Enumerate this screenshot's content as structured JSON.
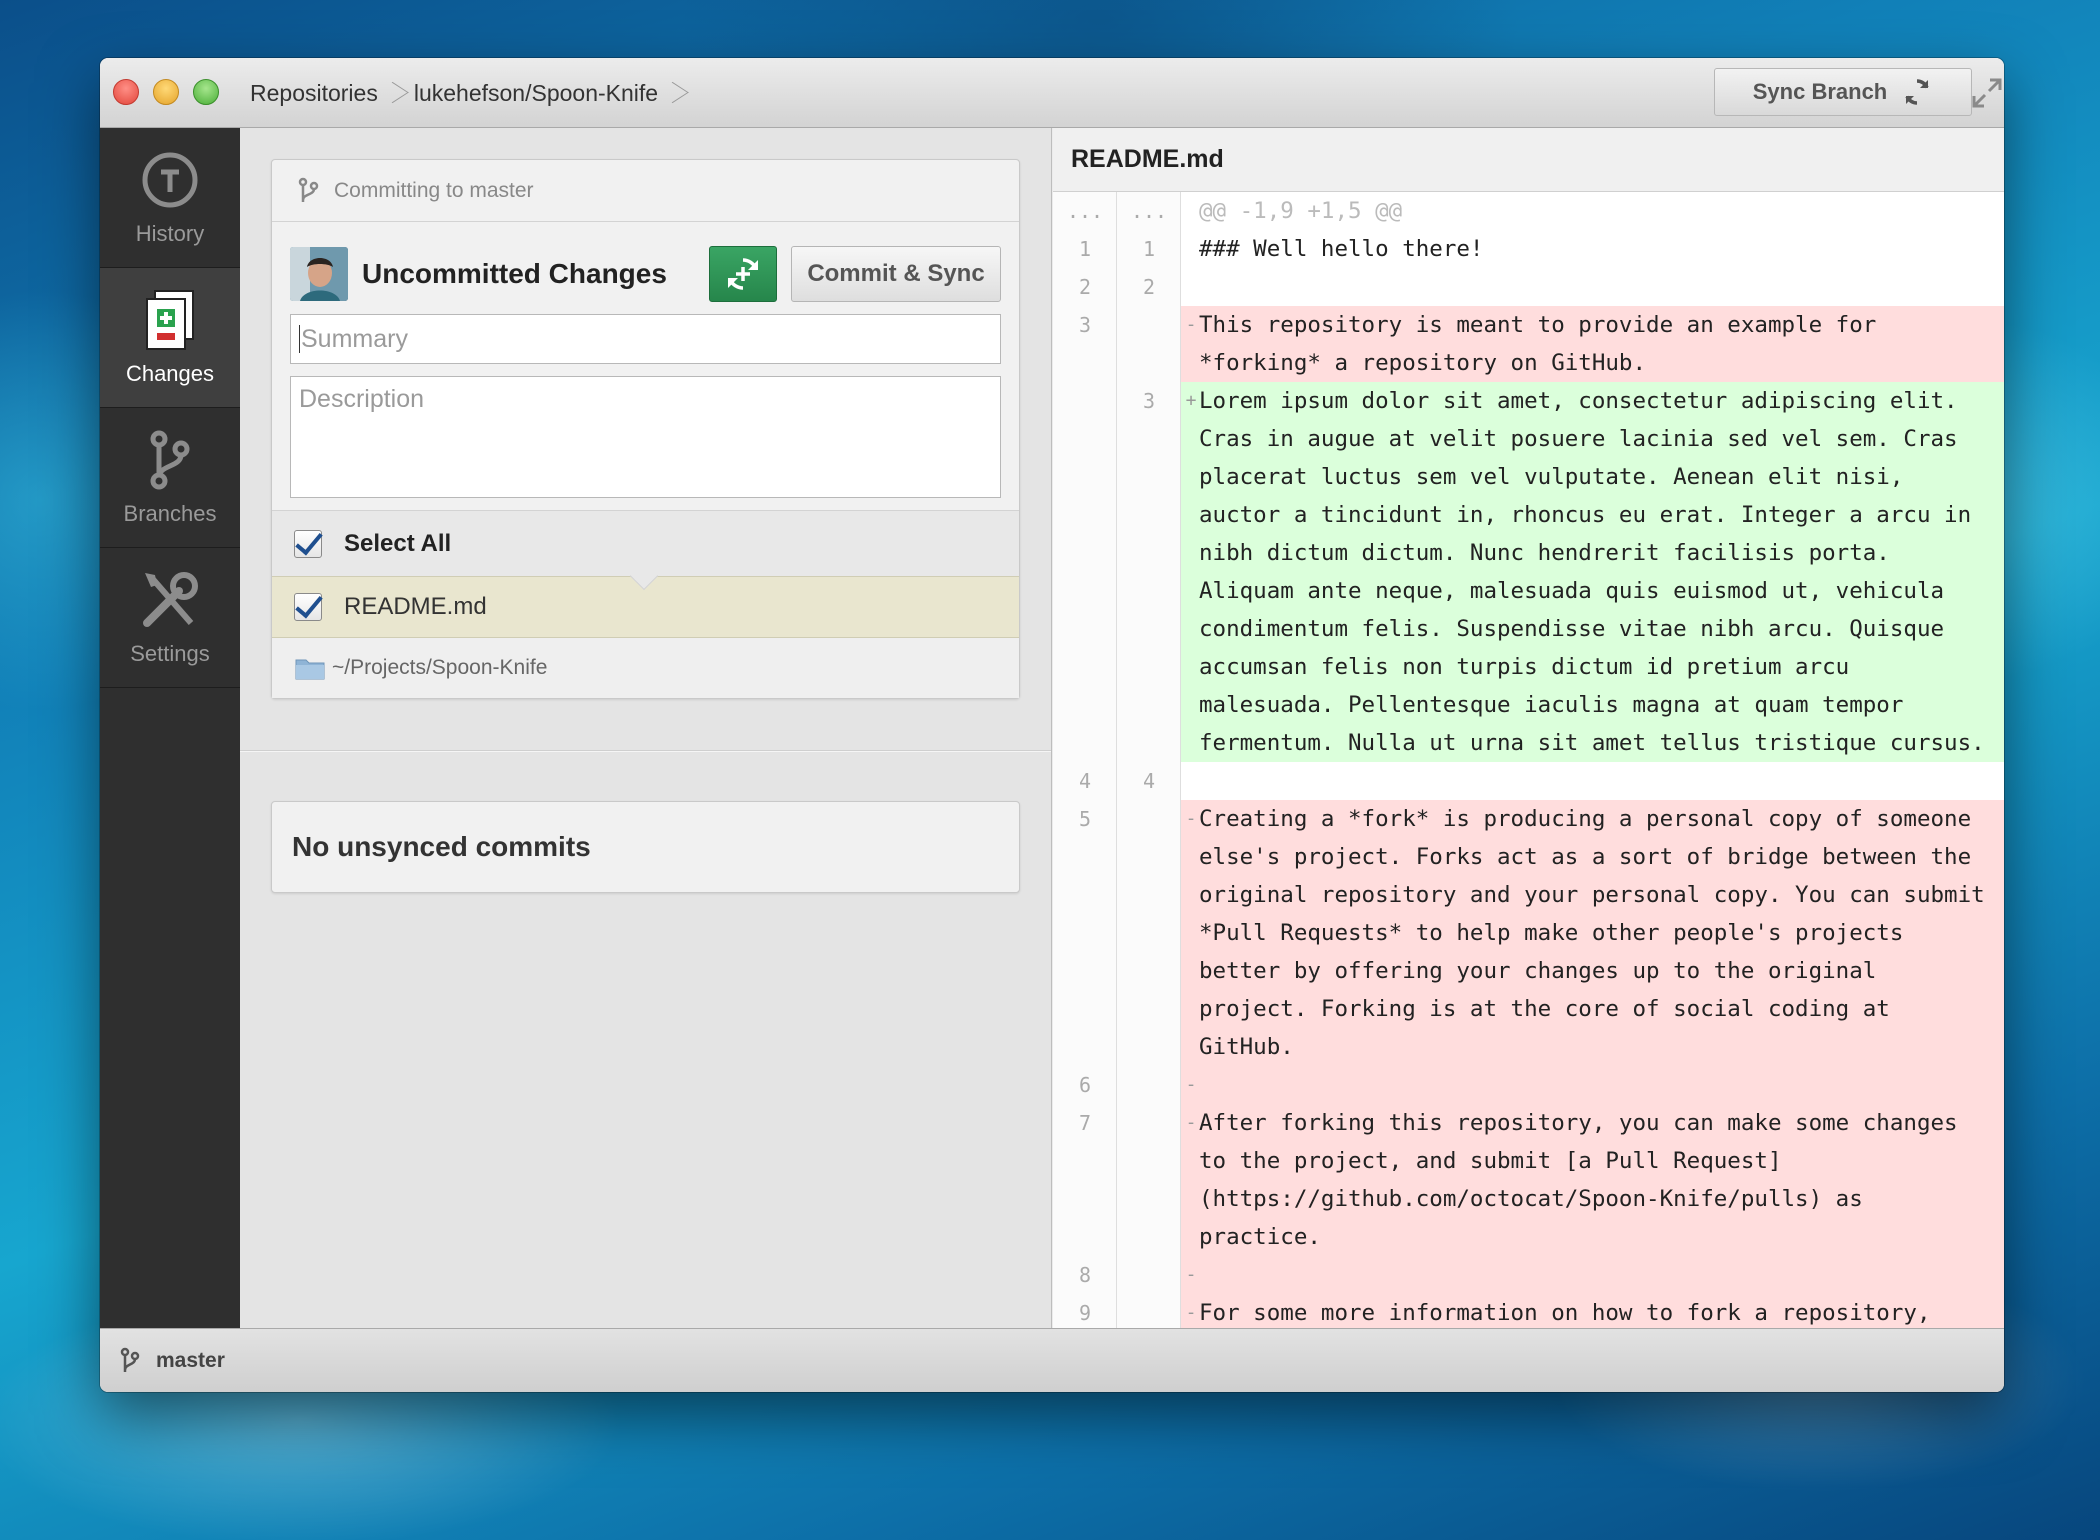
{
  "window": {
    "breadcrumb": [
      "Repositories",
      "lukehefson/Spoon-Knife"
    ],
    "sync_button": "Sync Branch"
  },
  "sidebar": {
    "items": [
      {
        "label": "History",
        "icon": "history-icon",
        "active": false
      },
      {
        "label": "Changes",
        "icon": "changes-icon",
        "active": true
      },
      {
        "label": "Branches",
        "icon": "branches-icon",
        "active": false
      },
      {
        "label": "Settings",
        "icon": "settings-icon",
        "active": false
      }
    ]
  },
  "commit": {
    "committing_to": "Committing to master",
    "title": "Uncommitted Changes",
    "commit_sync_label": "Commit & Sync",
    "summary_placeholder": "Summary",
    "description_placeholder": "Description",
    "select_all": "Select All",
    "file": "README.md",
    "path": "~/Projects/Spoon-Knife"
  },
  "unsynced": "No unsynced commits",
  "diff": {
    "filename": "README.md",
    "lines": [
      {
        "type": "hunk",
        "old": "...",
        "new": "...",
        "sign": "",
        "text": "@@ -1,9 +1,5 @@"
      },
      {
        "type": "ctx",
        "old": "1",
        "new": "1",
        "sign": "",
        "text": "### Well hello there!"
      },
      {
        "type": "ctx",
        "old": "2",
        "new": "2",
        "sign": "",
        "text": ""
      },
      {
        "type": "del",
        "old": "3",
        "new": "",
        "sign": "-",
        "text": "This repository is meant to provide an example for *forking* a repository on GitHub."
      },
      {
        "type": "add",
        "old": "",
        "new": "3",
        "sign": "+",
        "text": "Lorem ipsum dolor sit amet, consectetur adipiscing elit. Cras in augue at velit posuere lacinia sed vel sem. Cras placerat luctus sem vel vulputate. Aenean elit nisi, auctor a tincidunt in, rhoncus eu erat. Integer a arcu in nibh dictum dictum. Nunc hendrerit facilisis porta. Aliquam ante neque, malesuada quis euismod ut, vehicula condimentum felis. Suspendisse vitae nibh arcu. Quisque accumsan felis non turpis dictum id pretium arcu malesuada. Pellentesque iaculis magna at quam tempor fermentum. Nulla ut urna sit amet tellus tristique cursus."
      },
      {
        "type": "ctx",
        "old": "4",
        "new": "4",
        "sign": "",
        "text": ""
      },
      {
        "type": "del",
        "old": "5",
        "new": "",
        "sign": "-",
        "text": "Creating a *fork* is producing a personal copy of someone else's project. Forks act as a sort of bridge between the original repository and your personal copy. You can submit *Pull Requests* to help make other people's projects better by offering your changes up to the original project. Forking is at the core of social coding at GitHub."
      },
      {
        "type": "del",
        "old": "6",
        "new": "",
        "sign": "-",
        "text": ""
      },
      {
        "type": "del",
        "old": "7",
        "new": "",
        "sign": "-",
        "text": "After forking this repository, you can make some changes to the project, and submit [a Pull Request](https://github.com/octocat/Spoon-Knife/pulls) as practice."
      },
      {
        "type": "del",
        "old": "8",
        "new": "",
        "sign": "-",
        "text": ""
      },
      {
        "type": "del",
        "old": "9",
        "new": "",
        "sign": "-",
        "text": "For some more information on how to fork a repository,"
      }
    ]
  },
  "status": {
    "branch": "master"
  },
  "colors": {
    "accent_green": "#2f9a59",
    "deleted_bg": "#ffdddd",
    "added_bg": "#dbffdb"
  }
}
